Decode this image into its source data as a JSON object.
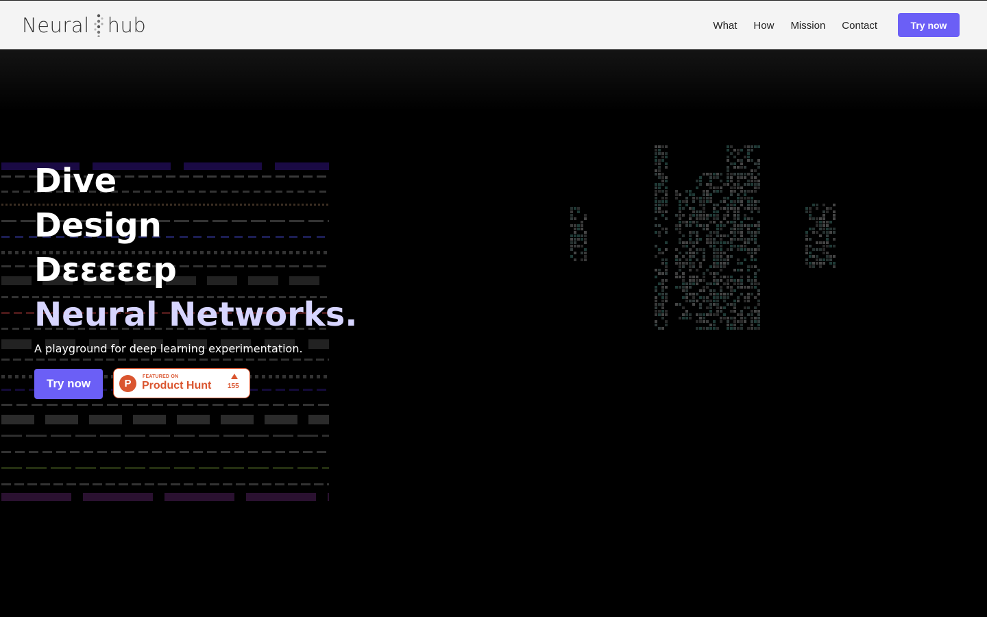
{
  "brand": {
    "name_left": "Neural",
    "name_right": "hub"
  },
  "nav": {
    "items": [
      "What",
      "How",
      "Mission",
      "Contact"
    ],
    "cta": "Try now"
  },
  "hero": {
    "lines": [
      "Dive",
      "Design",
      "Dεεεεεp",
      "Neural Networks."
    ],
    "tagline": "A playground for deep learning experimentation.",
    "cta": "Try now",
    "badge": {
      "small": "FEATURED ON",
      "name": "Product Hunt",
      "count": "155"
    }
  },
  "colors": {
    "accent": "#6b5ff6",
    "headline_accent": "#d7d5ff",
    "product_hunt": "#da552f"
  }
}
